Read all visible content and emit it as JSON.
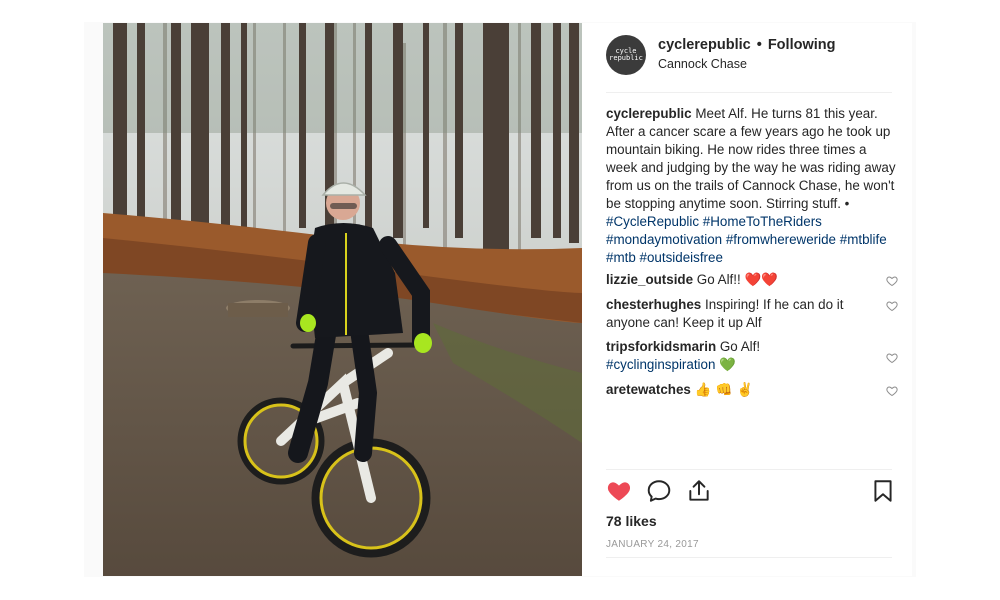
{
  "post": {
    "username": "cyclerepublic",
    "separator": "•",
    "follow_status": "Following",
    "location": "Cannock Chase",
    "avatar_text_line1": "cycle",
    "avatar_text_line2": "republic",
    "caption_user": "cyclerepublic",
    "caption_text": "Meet Alf. He turns 81 this year. After a cancer scare a few years ago he took up mountain biking. He now rides three times a week and judging by the way he was riding away from us on the trails of Cannock Chase, he won't be stopping anytime soon. Stirring stuff. •",
    "hashtags": [
      "#CycleRepublic",
      "#HomeToTheRiders",
      "#mondaymotivation",
      "#fromwhereweride",
      "#mtblife",
      "#mtb",
      "#outsideisfree"
    ],
    "likes": "78 likes",
    "date": "JANUARY 24, 2017"
  },
  "comments": [
    {
      "user": "lizzie_outside",
      "text": "Go Alf!!",
      "emoji": "❤️❤️",
      "emoji_color": "#ed1c24"
    },
    {
      "user": "chesterhughes",
      "text": "Inspiring! If he can do it anyone can! Keep it up Alf",
      "emoji": "",
      "emoji_color": ""
    },
    {
      "user": "tripsforkidsmarin",
      "text": "Go Alf!",
      "hashtag": "#cyclinginspiration",
      "emoji": "💚",
      "emoji_color": "#3cb043"
    },
    {
      "user": "aretewatches",
      "text": "",
      "emoji": "👍 👊 ✌️",
      "emoji_color": "#f4b400"
    }
  ],
  "icons": {
    "like": "heart-filled-icon",
    "comment": "comment-bubble-icon",
    "share": "share-upload-icon",
    "save": "bookmark-icon",
    "comment_like": "heart-outline-icon"
  },
  "colors": {
    "like_red": "#ed4956",
    "hashtag_blue": "#003569",
    "date_gray": "#999999"
  }
}
